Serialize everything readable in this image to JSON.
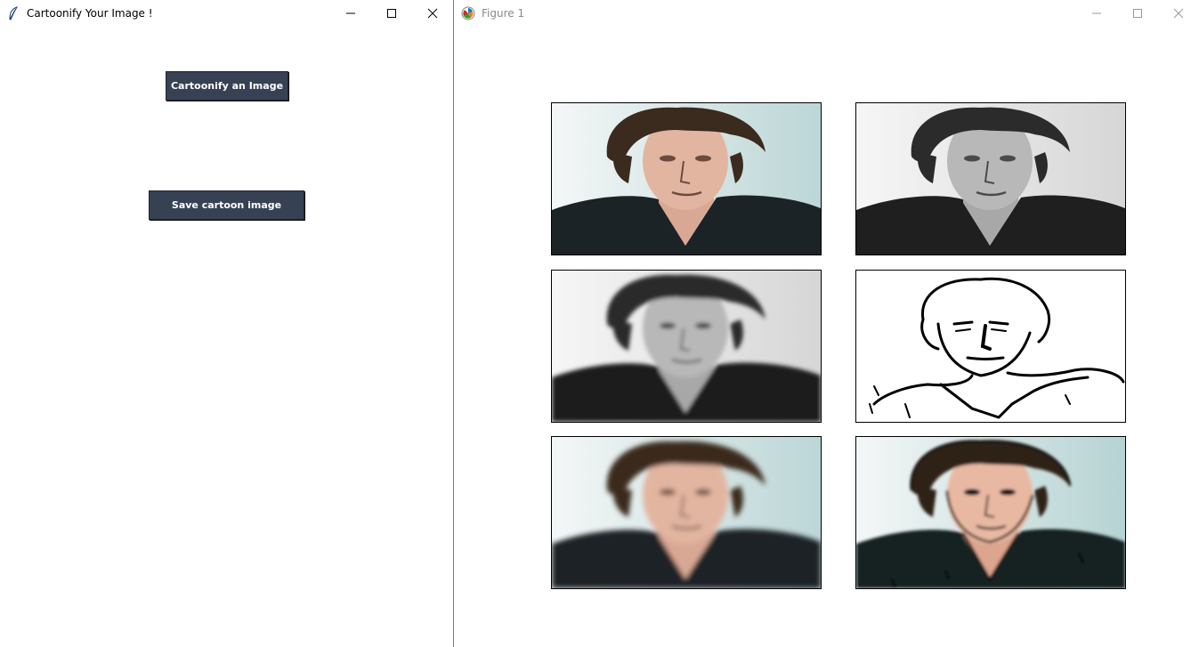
{
  "left_window": {
    "title": "Cartoonify Your Image !",
    "icon": "feather-icon",
    "buttons": {
      "cartoonify": "Cartoonify an Image",
      "save": "Save cartoon image"
    },
    "colors": {
      "button_bg": "#364154",
      "button_text": "#ffffff"
    }
  },
  "right_window": {
    "title": "Figure 1",
    "icon": "matplotlib-icon",
    "panels": [
      {
        "name": "original-photo",
        "style": "color"
      },
      {
        "name": "grayscale-photo",
        "style": "gray"
      },
      {
        "name": "smoothed-grayscale-photo",
        "style": "gray-blur"
      },
      {
        "name": "edge-mask",
        "style": "edges"
      },
      {
        "name": "color-smoothed-photo",
        "style": "color-blur"
      },
      {
        "name": "cartoon-result",
        "style": "cartoon"
      }
    ]
  }
}
